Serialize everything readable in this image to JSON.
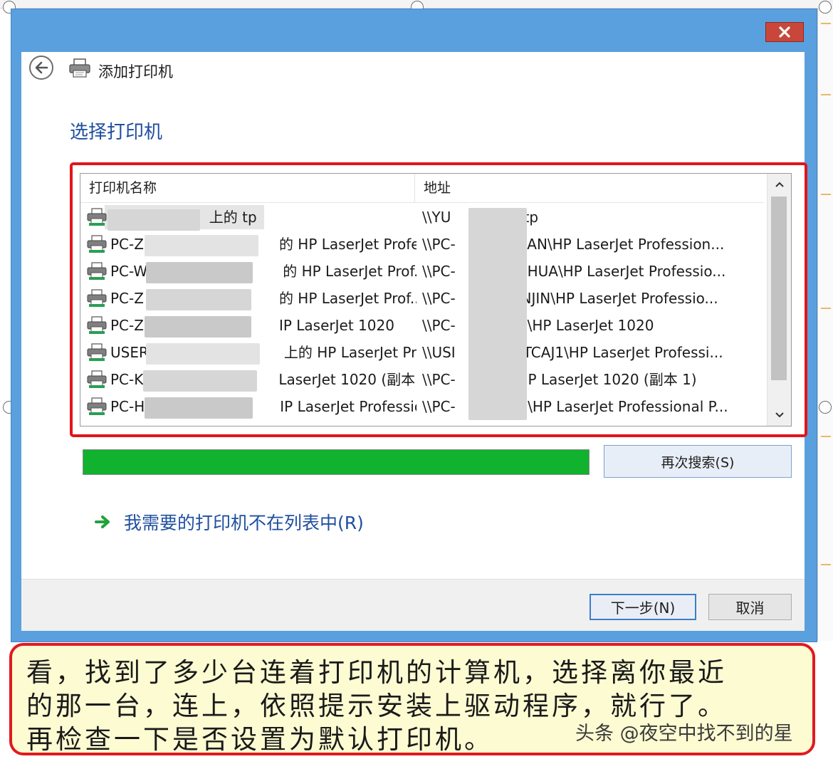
{
  "window": {
    "title": "添加打印机",
    "close_label": "✕"
  },
  "page": {
    "heading": "选择打印机"
  },
  "list": {
    "columns": [
      "打印机名称",
      "地址"
    ],
    "rows": [
      {
        "name_prefix": "\\",
        "name_suffix": "上的 tp",
        "addr_prefix": "\\\\YU",
        "addr_suffix": "G\\tp",
        "selected": true
      },
      {
        "name_prefix": "PC-Z",
        "name_suffix": "的 HP LaserJet Profe...",
        "addr_prefix": "\\\\PC-",
        "addr_suffix": "JUAN\\HP LaserJet Profession...",
        "selected": false
      },
      {
        "name_prefix": "PC-W",
        "name_suffix": "的 HP LaserJet Prof...",
        "addr_prefix": "\\\\PC-",
        "addr_suffix": "INHUA\\HP LaserJet Professio...",
        "selected": false
      },
      {
        "name_prefix": "PC-Z",
        "name_suffix": "的 HP LaserJet Prof...",
        "addr_prefix": "\\\\PC-",
        "addr_suffix": "JINJIN\\HP LaserJet Professio...",
        "selected": false
      },
      {
        "name_prefix": "PC-Z",
        "name_suffix": "IP LaserJet 1020",
        "addr_prefix": "\\\\PC-",
        "addr_suffix": "IN\\HP LaserJet 1020",
        "selected": false
      },
      {
        "name_prefix": "USER",
        "name_suffix": "上的 HP LaserJet Pro...",
        "addr_prefix": "\\\\USI",
        "addr_suffix": "HTCAJ1\\HP LaserJet Professi...",
        "selected": false
      },
      {
        "name_prefix": "PC-K",
        "name_suffix": "LaserJet 1020 (副本 ...",
        "addr_prefix": "\\\\PC-",
        "addr_suffix": "\\HP LaserJet 1020 (副本 1)",
        "selected": false
      },
      {
        "name_prefix": "PC-H",
        "name_suffix": "IP LaserJet Professio...",
        "addr_prefix": "\\\\PC-",
        "addr_suffix": "IG\\HP LaserJet Professional P...",
        "selected": false
      }
    ]
  },
  "search": {
    "progress_fraction": 1.0,
    "again_label": "再次搜索(S)"
  },
  "links": {
    "not_listed": "我需要的打印机不在列表中(R)"
  },
  "buttons": {
    "next": "下一步(N)",
    "cancel": "取消"
  },
  "annotation": {
    "lines": [
      "看，找到了多少台连着打印机的计算机，选择离你最近",
      "的那一台，连上，依照提示安装上驱动程序，就行了。",
      "再检查一下是否设置为默认打印机。"
    ],
    "watermark": "头条 @夜空中找不到的星"
  },
  "icons": {
    "close": "close-icon",
    "back": "back-arrow-icon",
    "title_printer": "printer-icon",
    "row_printer": "network-printer-icon",
    "scroll_up": "chevron-up-icon",
    "scroll_down": "chevron-down-icon",
    "link_arrow": "green-arrow-icon"
  },
  "colors": {
    "dialog_frame": "#5aa0de",
    "heading_blue": "#1f4fa0",
    "highlight_red": "#e2141b",
    "progress_green": "#10b22e",
    "close_red": "#c9473a",
    "note_bg": "#fdfbd2"
  }
}
